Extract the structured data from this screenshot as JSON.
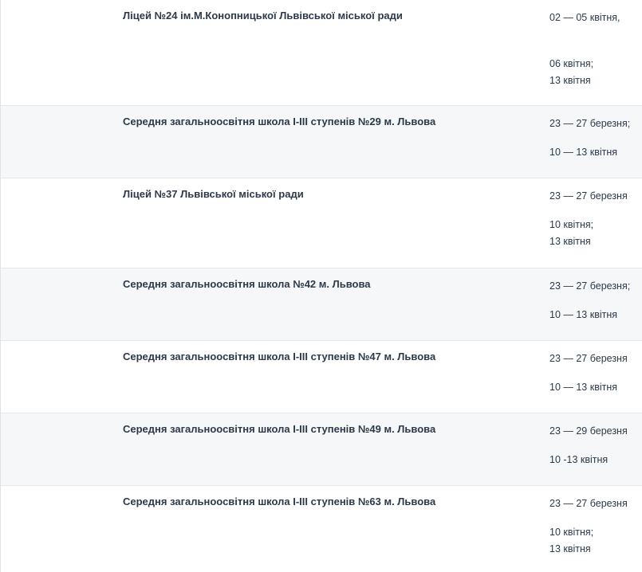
{
  "rows": [
    {
      "school": "Ліцей №24 ім.М.Конопницької Львівської міської ради",
      "dates": [
        "02 — 05 квітня,",
        "06 квітня;",
        "13 квітня"
      ]
    },
    {
      "school": "Середня загальноосвітня школа І-ІІІ ступенів №29 м. Львова",
      "dates": [
        "23 — 27 березня;",
        "10 — 13 квітня"
      ]
    },
    {
      "school": "Ліцей №37 Львівської міської ради",
      "dates": [
        "23 — 27 березня",
        "10 квітня;",
        "13 квітня"
      ]
    },
    {
      "school": "Середня загальноосвітня школа №42 м. Львова",
      "dates": [
        "23 — 27 березня;",
        "10 — 13 квітня"
      ]
    },
    {
      "school": "Середня загальноосвітня школа І-ІІІ ступенів №47 м. Львова",
      "dates": [
        "23 — 27 березня",
        "10 — 13 квітня"
      ]
    },
    {
      "school": "Середня загальноосвітня школа І-ІІІ ступенів №49 м. Львова",
      "dates": [
        "23 — 29 березня",
        "10 -13 квітня"
      ]
    },
    {
      "school": "Середня загальноосвітня школа І-ІІІ ступенів №63 м. Львова",
      "dates": [
        "23 — 27 березня",
        "10 квітня;",
        "13 квітня"
      ]
    }
  ]
}
